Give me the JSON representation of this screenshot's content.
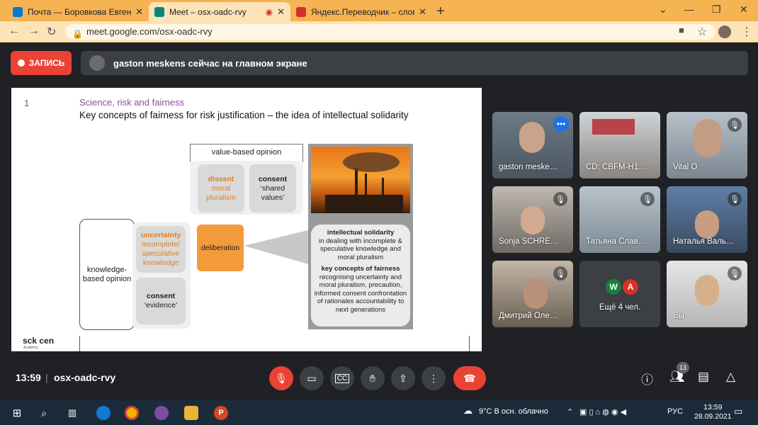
{
  "browser": {
    "tabs": [
      {
        "title": "Почта — Боровкова Евгения Се",
        "color": "#0078d4"
      },
      {
        "title": "Meet – osx-oadc-rvy",
        "color": "#00897b"
      },
      {
        "title": "Яндекс.Переводчик – словарь и",
        "color": "#d32f2f"
      }
    ],
    "new_tab": "+",
    "url": "meet.google.com/osx-oadc-rvy"
  },
  "meet": {
    "record_label": "ЗАПИСЬ",
    "presenting_text": "gaston meskens сейчас на главном экране",
    "time": "13:59",
    "meeting_code": "osx-oadc-rvy",
    "people_count": "13"
  },
  "slide": {
    "number": "1",
    "title": "Science, risk and fairness",
    "subtitle": "Key concepts of fairness for risk justification – the idea of intellectual solidarity",
    "value_based": "value-based opinion",
    "dissent_title": "dissent",
    "dissent_text": "moral pluralism",
    "consent_shared_title": "consent",
    "consent_shared_text": "‘shared values’",
    "knowledge_based": "knowledge-based opinion",
    "uncertainty_title": "uncertainty",
    "uncertainty_text": "incomplete/ speculative knowledge",
    "consent_evidence_title": "consent",
    "consent_evidence_text": "‘evidence’",
    "deliberation": "deliberation",
    "solidarity_title": "intellectual solidarity",
    "solidarity_text": "in dealing with incomplete & speculative knowledge and moral pluralism",
    "fairness_title": "key concepts of fairness",
    "fairness_text": "recognising uncertainty and moral pluralism, precaution, informed consent confrontation of rationales accountability to next generations",
    "logo": "sck cen",
    "logo_sub": "Academy"
  },
  "participants": [
    {
      "name": "gaston meske…"
    },
    {
      "name": "CD: CBFM-H1…"
    },
    {
      "name": "Vital O"
    },
    {
      "name": "Sonja SCHRE…"
    },
    {
      "name": "Татьяна Слав…"
    },
    {
      "name": "Наталья Валь…"
    },
    {
      "name": "Дмитрий Оле…"
    },
    {
      "name": "Ещё 4 чел.",
      "avatars": [
        "W",
        "A"
      ]
    },
    {
      "name": "Вы"
    }
  ],
  "taskbar": {
    "weather": "9°C  В осн. облачно",
    "lang": "РУС",
    "clock_time": "13:59",
    "clock_date": "28.09.2021"
  }
}
